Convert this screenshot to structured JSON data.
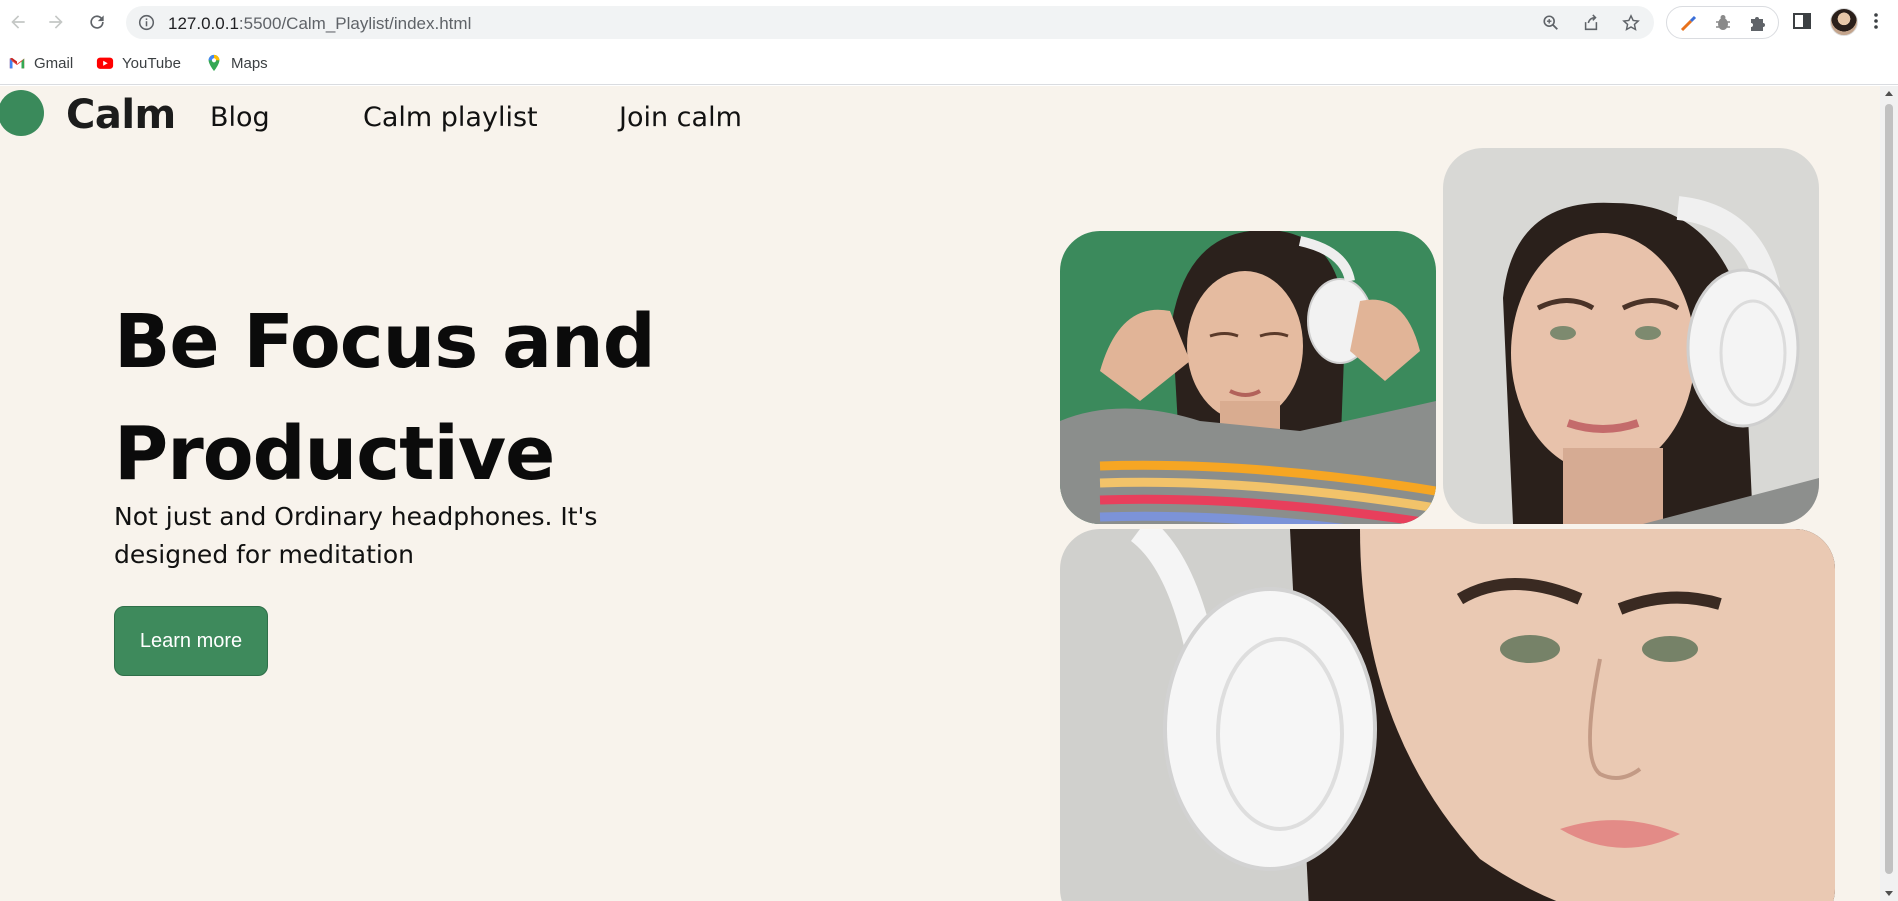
{
  "browser": {
    "url_host": "127.0.0.1",
    "url_path": ":5500/Calm_Playlist/index.html",
    "bookmarks": [
      {
        "label": "Gmail",
        "icon": "gmail-icon"
      },
      {
        "label": "YouTube",
        "icon": "youtube-icon"
      },
      {
        "label": "Maps",
        "icon": "maps-icon"
      }
    ]
  },
  "site": {
    "brand": "Calm",
    "nav": [
      "Blog",
      "Calm playlist",
      "Join calm"
    ],
    "headline_line1": "Be Focus and",
    "headline_line2": "Productive",
    "subtitle": "Not just and Ordinary headphones. It's designed for meditation",
    "cta_label": "Learn more",
    "accent_color": "#3e8a5c",
    "background_color": "#f8f3ec"
  }
}
